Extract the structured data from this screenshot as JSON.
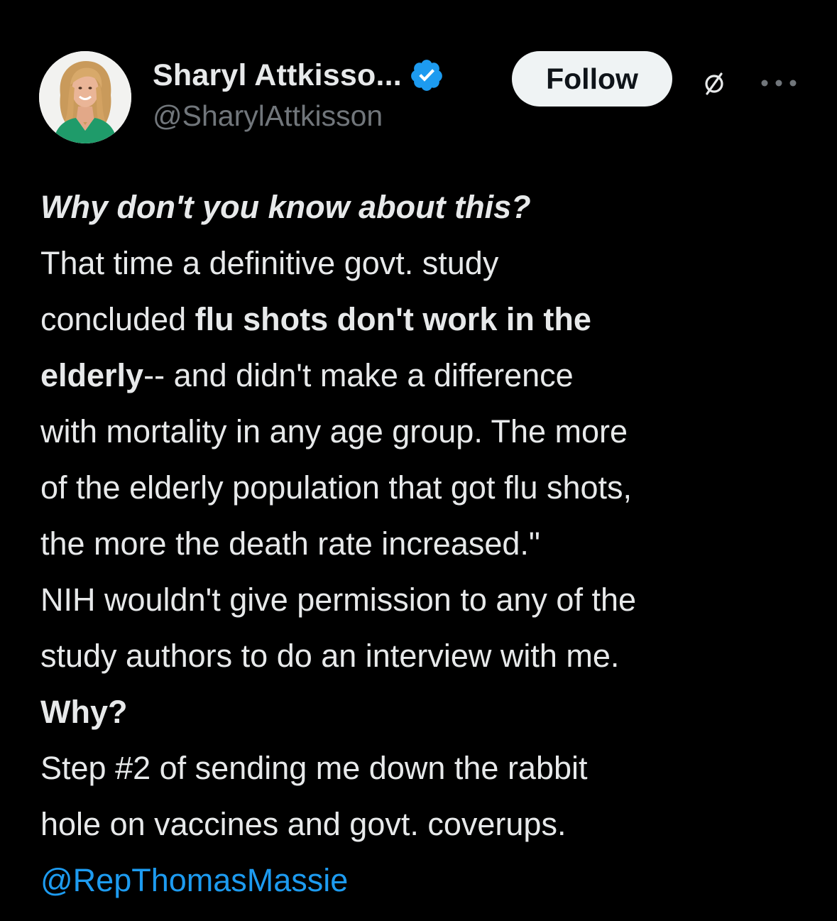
{
  "author": {
    "display_name": "Sharyl Attkisso...",
    "handle": "@SharylAttkisson",
    "verified": true,
    "avatar_icon": "profile-photo",
    "badge_color": "#1d9bf0"
  },
  "actions": {
    "follow_label": "Follow",
    "grok_icon": "grok-icon",
    "more_icon": "more-horizontal-icon"
  },
  "tweet": {
    "heading": "Why don't you know about this?",
    "line2": "That time a definitive govt. study",
    "line3_prefix": "concluded ",
    "line3_bold": "flu shots don't work in the",
    "line4_bold": "elderly",
    "line4_rest": "-- and didn't make a difference",
    "line5": "with mortality in any age group. The more",
    "line6": "of the elderly population that got flu shots,",
    "line7": "the more the death rate increased.\"",
    "line8": "NIH wouldn't give permission to any of the",
    "line9": "study authors to do an interview with me.",
    "line10_bold": "Why?",
    "line11": "Step #2 of sending me down the rabbit",
    "line12": "hole on vaccines and govt. coverups.",
    "mention": "@RepThomasMassie"
  },
  "colors": {
    "background": "#000000",
    "text": "#e7e9ea",
    "secondary": "#71767b",
    "link": "#1d9bf0"
  }
}
